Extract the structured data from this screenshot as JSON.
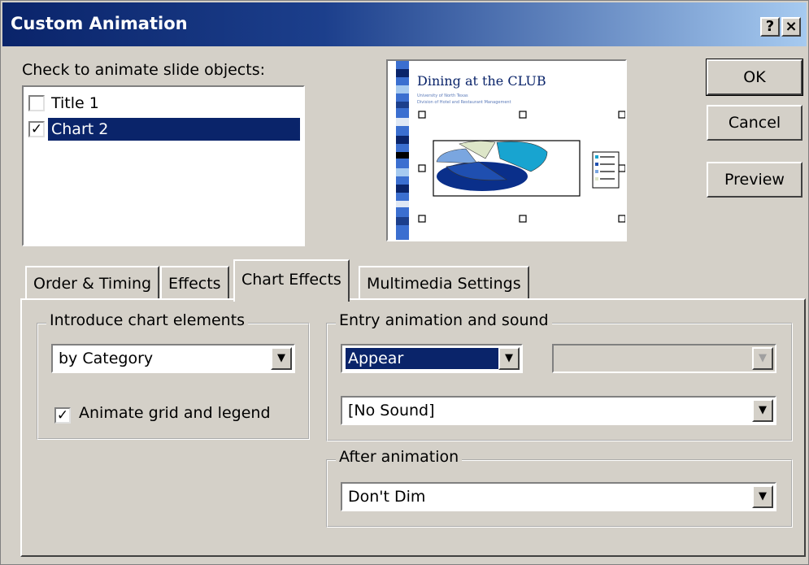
{
  "window": {
    "title": "Custom Animation",
    "help": "?",
    "close": "×"
  },
  "objects": {
    "label": "Check to animate slide objects:",
    "items": [
      {
        "label": "Title 1",
        "checked": false
      },
      {
        "label": "Chart 2",
        "checked": true,
        "selected": true
      }
    ]
  },
  "preview": {
    "slide_title": "Dining at the CLUB",
    "line1": "University of North Texas",
    "line2": "Division of Hotel and Restaurant Management"
  },
  "buttons": {
    "ok": "OK",
    "cancel": "Cancel",
    "preview": "Preview"
  },
  "tabs": [
    {
      "label": "Order & Timing"
    },
    {
      "label": "Effects"
    },
    {
      "label": "Chart Effects",
      "active": true
    },
    {
      "label": "Multimedia Settings"
    }
  ],
  "chart_effects": {
    "introduce": {
      "title": "Introduce chart elements",
      "value": "by Category"
    },
    "animate_grid": {
      "label": "Animate grid and legend",
      "checked": true
    },
    "entry": {
      "title": "Entry animation and sound",
      "effect": "Appear",
      "direction": "",
      "sound": "[No Sound]"
    },
    "after": {
      "title": "After animation",
      "value": "Don't Dim"
    }
  },
  "colors": {
    "title_start": "#0a246a",
    "title_end": "#a6caf0",
    "selection": "#0a246a",
    "face": "#d4d0c8"
  }
}
